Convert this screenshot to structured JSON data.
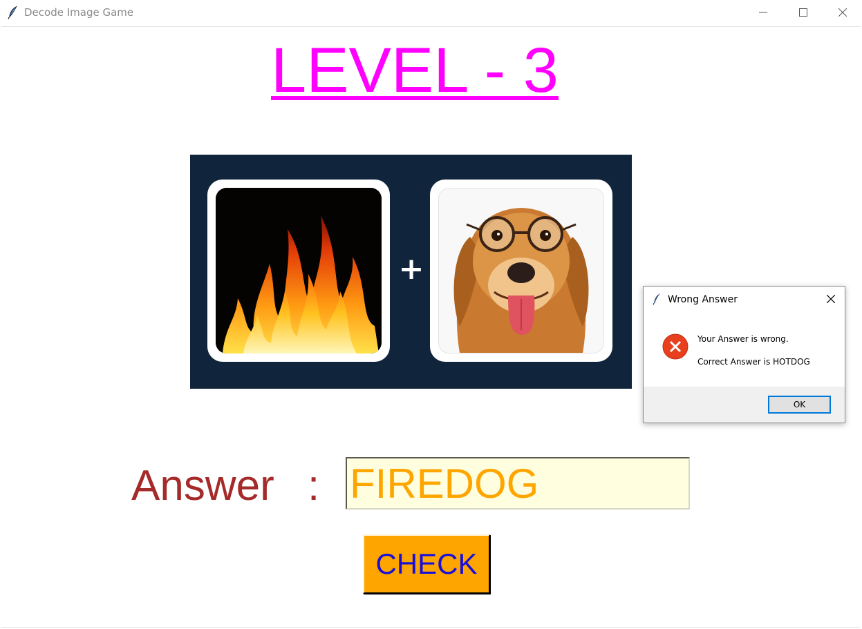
{
  "window": {
    "title": "Decode Image Game",
    "icon": "feather-icon"
  },
  "game": {
    "level_title": "LEVEL - 3",
    "level_color": "#ff00ff",
    "puzzle": {
      "left_image": "fire-image",
      "operator": "+",
      "right_image": "dog-with-glasses-image"
    },
    "answer_label": "Answer",
    "answer_separator": ":",
    "answer_value": "FIREDOG",
    "check_label": "CHECK",
    "check_color": "#ffa500"
  },
  "dialog": {
    "title": "Wrong Answer",
    "icon": "error-icon",
    "message_line1": "Your Answer is wrong.",
    "message_line2": "Correct Answer is HOTDOG",
    "ok_label": "OK"
  }
}
